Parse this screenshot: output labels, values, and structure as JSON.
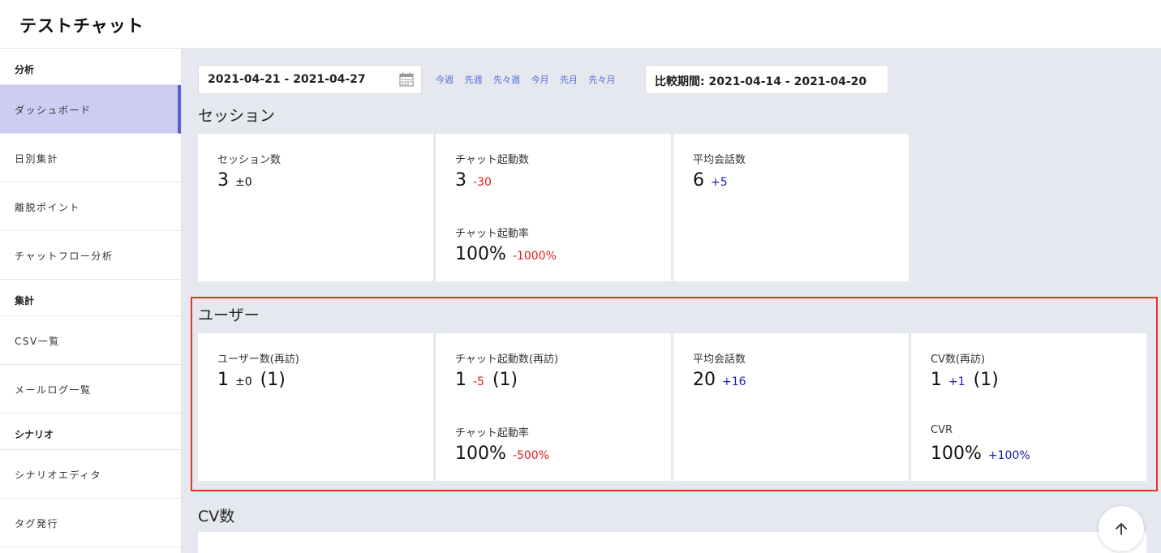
{
  "app_title": "テストチャット",
  "sidebar": {
    "sections": [
      {
        "title": "分析",
        "items": [
          "ダッシュボード",
          "日別集計",
          "離脱ポイント",
          "チャットフロー分析"
        ]
      },
      {
        "title": "集計",
        "items": [
          "CSV一覧",
          "メールログ一覧"
        ]
      },
      {
        "title": "シナリオ",
        "items": [
          "シナリオエディタ",
          "タグ発行"
        ]
      }
    ],
    "active_item": "ダッシュボード"
  },
  "filters": {
    "date_range": "2021-04-21 - 2021-04-27",
    "quick_links": [
      "今週",
      "先週",
      "先々週",
      "今月",
      "先月",
      "先々月"
    ],
    "compare_period": "比較期間: 2021-04-14 - 2021-04-20"
  },
  "sessions": {
    "title": "セッション",
    "session_count": {
      "label": "セッション数",
      "value": "3",
      "diff": "±0"
    },
    "chat_starts": {
      "label": "チャット起動数",
      "value": "3",
      "diff": "-30"
    },
    "chat_start_rate": {
      "label": "チャット起動率",
      "value": "100%",
      "diff": "-1000%"
    },
    "avg_conversations": {
      "label": "平均会話数",
      "value": "6",
      "diff": "+5"
    }
  },
  "users": {
    "title": "ユーザー",
    "user_count": {
      "label": "ユーザー数(再訪)",
      "value": "1",
      "diff": "±0",
      "extra": "(1)"
    },
    "chat_starts": {
      "label": "チャット起動数(再訪)",
      "value": "1",
      "diff": "-5",
      "extra": "(1)"
    },
    "chat_start_rate": {
      "label": "チャット起動率",
      "value": "100%",
      "diff": "-500%"
    },
    "avg_conversations": {
      "label": "平均会話数",
      "value": "20",
      "diff": "+16"
    },
    "cv_count": {
      "label": "CV数(再訪)",
      "value": "1",
      "diff": "+1",
      "extra": "(1)"
    },
    "cvr": {
      "label": "CVR",
      "value": "100%",
      "diff": "+100%"
    }
  },
  "cv": {
    "title": "CV数"
  },
  "colors": {
    "accent": "#5b5fd8",
    "active_bg": "#cdcdf3",
    "negative": "#e21c1c",
    "positive": "#1b1bb0",
    "highlight_border": "#e3341f",
    "link": "#4e6ad8"
  }
}
